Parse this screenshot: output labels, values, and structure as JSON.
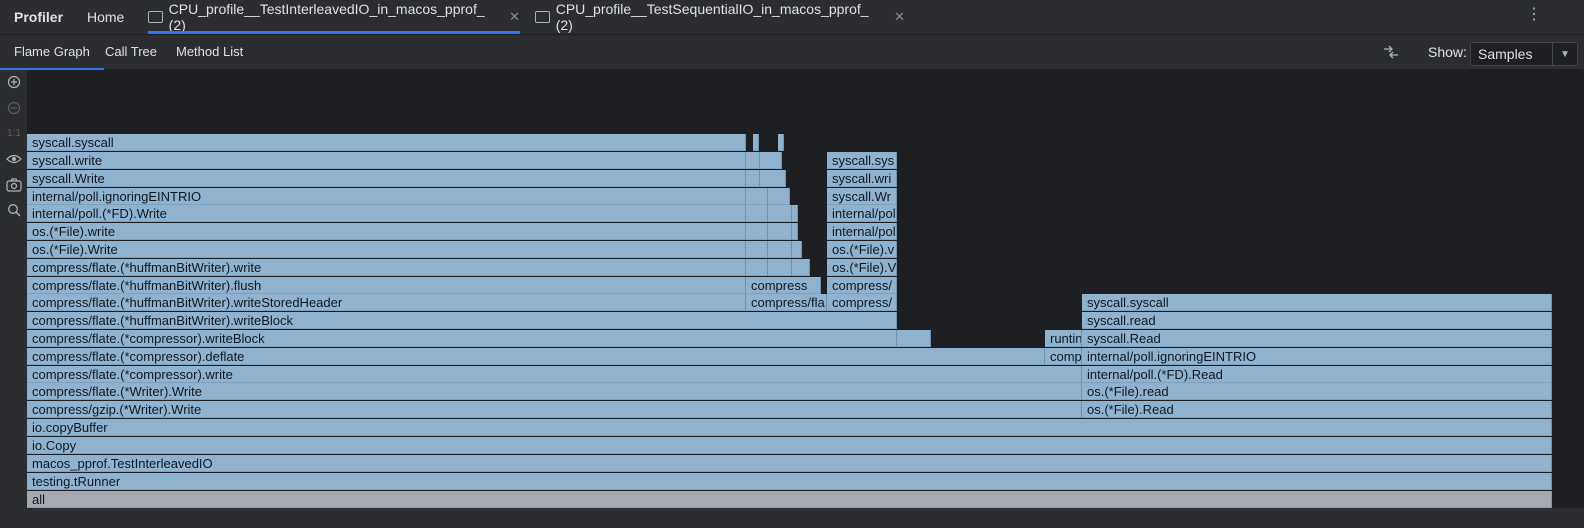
{
  "header": {
    "brand": "Profiler",
    "home": "Home",
    "tabs": [
      {
        "label": "CPU_profile__TestInterleavedIO_in_macos_pprof_ (2)",
        "active": true
      },
      {
        "label": "CPU_profile__TestSequentialIO_in_macos_pprof_ (2)",
        "active": false
      }
    ],
    "close_glyph": "✕",
    "more_glyph": "⋮"
  },
  "toolbar": {
    "tabs": [
      "Flame Graph",
      "Call Tree",
      "Method List"
    ],
    "show_label": "Show:",
    "show_value": "Samples"
  },
  "side_icons": [
    "zoom-in-icon",
    "zoom-out-icon",
    "actual-size-icon",
    "eye-icon",
    "camera-icon",
    "search-icon"
  ],
  "actual_size_label": "1:1",
  "flame": {
    "frames": [
      {
        "label": "all"
      },
      {
        "label": "testing.tRunner"
      },
      {
        "label": "macos_pprof.TestInterleavedIO"
      },
      {
        "label": "io.Copy"
      },
      {
        "label": "io.copyBuffer"
      },
      {
        "label": "compress/gzip.(*Writer).Write"
      },
      {
        "label": "compress/flate.(*Writer).Write"
      },
      {
        "label": "compress/flate.(*compressor).write"
      },
      {
        "label": "compress/flate.(*compressor).deflate"
      },
      {
        "label": "compress/flate.(*compressor).writeBlock"
      },
      {
        "label": "compress/flate.(*huffmanBitWriter).writeBlock"
      },
      {
        "label": "compress/flate.(*huffmanBitWriter).writeStoredHeader"
      },
      {
        "label": "compress/flate.(*huffmanBitWriter).flush"
      },
      {
        "label": "compress/flate.(*huffmanBitWriter).write"
      },
      {
        "label": "os.(*File).Write"
      },
      {
        "label": "os.(*File).write"
      },
      {
        "label": "internal/poll.(*FD).Write"
      },
      {
        "label": "internal/poll.ignoringEINTRIO"
      },
      {
        "label": "syscall.Write"
      },
      {
        "label": "syscall.write"
      },
      {
        "label": "syscall.syscall"
      },
      {
        "label": "compress/fla"
      },
      {
        "label": "compress"
      },
      {
        "label": "compress/"
      },
      {
        "label": "compress/"
      },
      {
        "label": "os.(*File).V"
      },
      {
        "label": "os.(*File).v"
      },
      {
        "label": "internal/poll"
      },
      {
        "label": "internal/poll"
      },
      {
        "label": "syscall.Wr"
      },
      {
        "label": "syscall.wri"
      },
      {
        "label": "syscall.sys"
      },
      {
        "label": "runtin"
      },
      {
        "label": "comp"
      },
      {
        "label": "os.(*File).Read"
      },
      {
        "label": "os.(*File).read"
      },
      {
        "label": "internal/poll.(*FD).Read"
      },
      {
        "label": "internal/poll.ignoringEINTRIO"
      },
      {
        "label": "syscall.Read"
      },
      {
        "label": "syscall.read"
      },
      {
        "label": "syscall.syscall"
      }
    ]
  }
}
